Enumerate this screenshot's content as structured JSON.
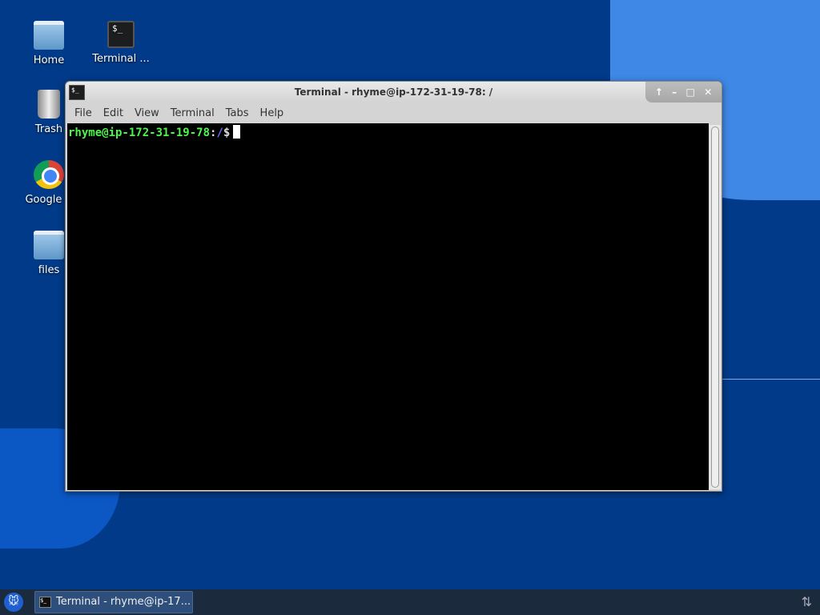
{
  "desktop": {
    "icons": [
      {
        "label": "Home",
        "icon": "home-folder-icon"
      },
      {
        "label": "Terminal ...",
        "icon": "terminal-icon"
      },
      {
        "label": "Trash",
        "icon": "trash-icon"
      },
      {
        "label": "Google C",
        "icon": "chrome-icon"
      },
      {
        "label": "files",
        "icon": "folder-icon"
      }
    ]
  },
  "window": {
    "title": "Terminal - rhyme@ip-172-31-19-78: /",
    "menu": [
      "File",
      "Edit",
      "View",
      "Terminal",
      "Tabs",
      "Help"
    ],
    "prompt": {
      "user_host": "rhyme@ip-172-31-19-78",
      "sep": ":",
      "path": "/",
      "symbol": "$"
    },
    "buttons": {
      "shade": "↑",
      "minimize": "–",
      "maximize": "□",
      "close": "✕"
    }
  },
  "taskbar": {
    "task_label": "Terminal - rhyme@ip-17...",
    "tray_icon": "network-icon",
    "tray_glyph": "⇅"
  },
  "colors": {
    "desktop": "#013a89",
    "prompt_user": "#4df54d",
    "prompt_path": "#6b6bff"
  }
}
